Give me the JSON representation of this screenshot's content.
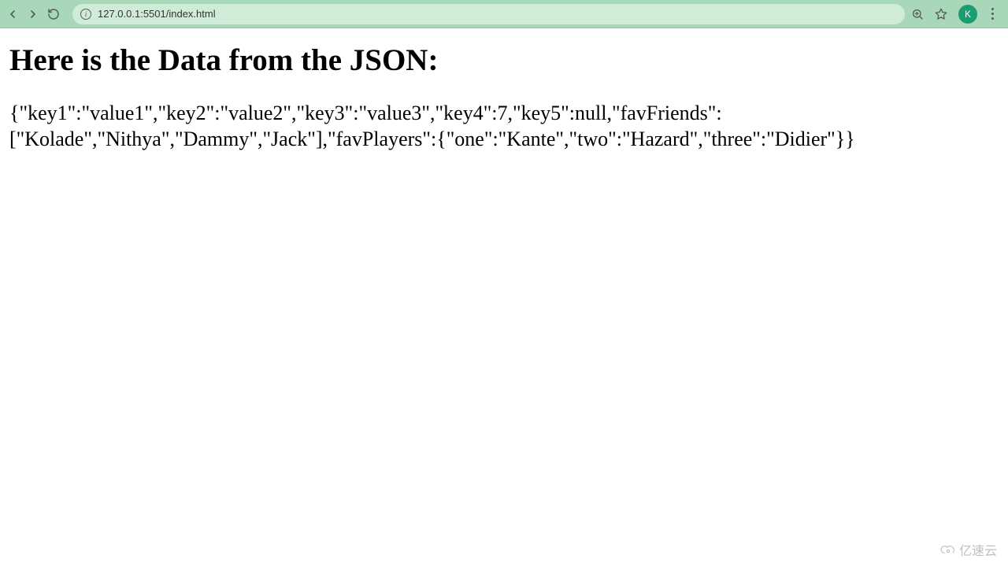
{
  "browser": {
    "url": "127.0.0.1:5501/index.html",
    "avatar_letter": "K"
  },
  "page": {
    "heading": "Here is the Data from the JSON:",
    "json_output": "{\"key1\":\"value1\",\"key2\":\"value2\",\"key3\":\"value3\",\"key4\":7,\"key5\":null,\"favFriends\":[\"Kolade\",\"Nithya\",\"Dammy\",\"Jack\"],\"favPlayers\":{\"one\":\"Kante\",\"two\":\"Hazard\",\"three\":\"Didier\"}}"
  },
  "watermark": {
    "text": "亿速云"
  }
}
